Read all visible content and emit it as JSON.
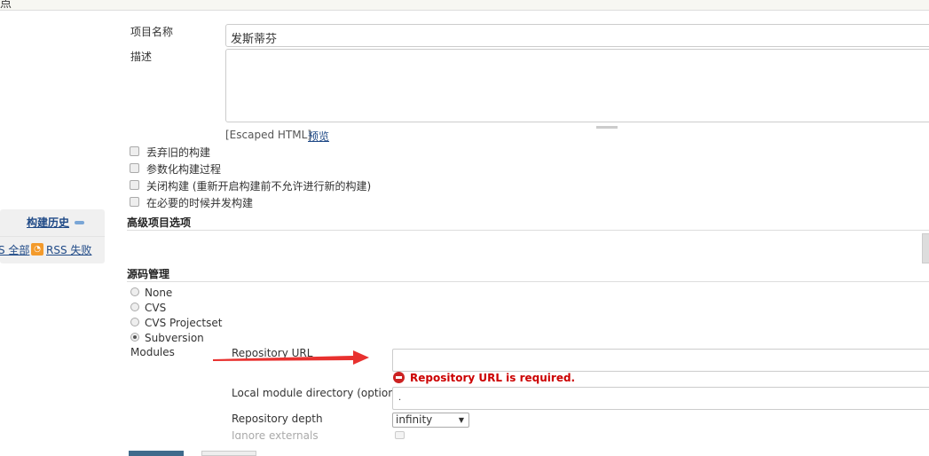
{
  "header": {
    "title_fragment": "点"
  },
  "sidebar": {
    "build_history": "构建历史",
    "rss_all": "S 全部",
    "rss_fail": "RSS 失败"
  },
  "form": {
    "project_name_label": "项目名称",
    "project_name_value": "发斯蒂芬",
    "description_label": "描述",
    "description_value": "",
    "escaped_html": "[Escaped HTML]",
    "preview": "预览",
    "checkboxes": [
      {
        "label": "丢弃旧的构建",
        "checked": false
      },
      {
        "label": "参数化构建过程",
        "checked": false
      },
      {
        "label": "关闭构建 (重新开启构建前不允许进行新的构建)",
        "checked": false
      },
      {
        "label": "在必要的时候并发构建",
        "checked": false
      }
    ],
    "advanced_title": "高级项目选项",
    "scm_title": "源码管理",
    "scm_options": [
      {
        "label": "None",
        "selected": false
      },
      {
        "label": "CVS",
        "selected": false
      },
      {
        "label": "CVS Projectset",
        "selected": false
      },
      {
        "label": "Subversion",
        "selected": true
      }
    ],
    "modules_label": "Modules",
    "repo_url_label": "Repository URL",
    "repo_url_value": "",
    "repo_url_error": "Repository URL is required.",
    "local_dir_label": "Local module directory (optional)",
    "local_dir_value": ".",
    "depth_label": "Repository depth",
    "depth_value": "infinity",
    "ignore_externals_label": "Ignore externals"
  },
  "colors": {
    "error": "#cc0000",
    "arrow": "#e8312f",
    "link": "#204a87"
  }
}
